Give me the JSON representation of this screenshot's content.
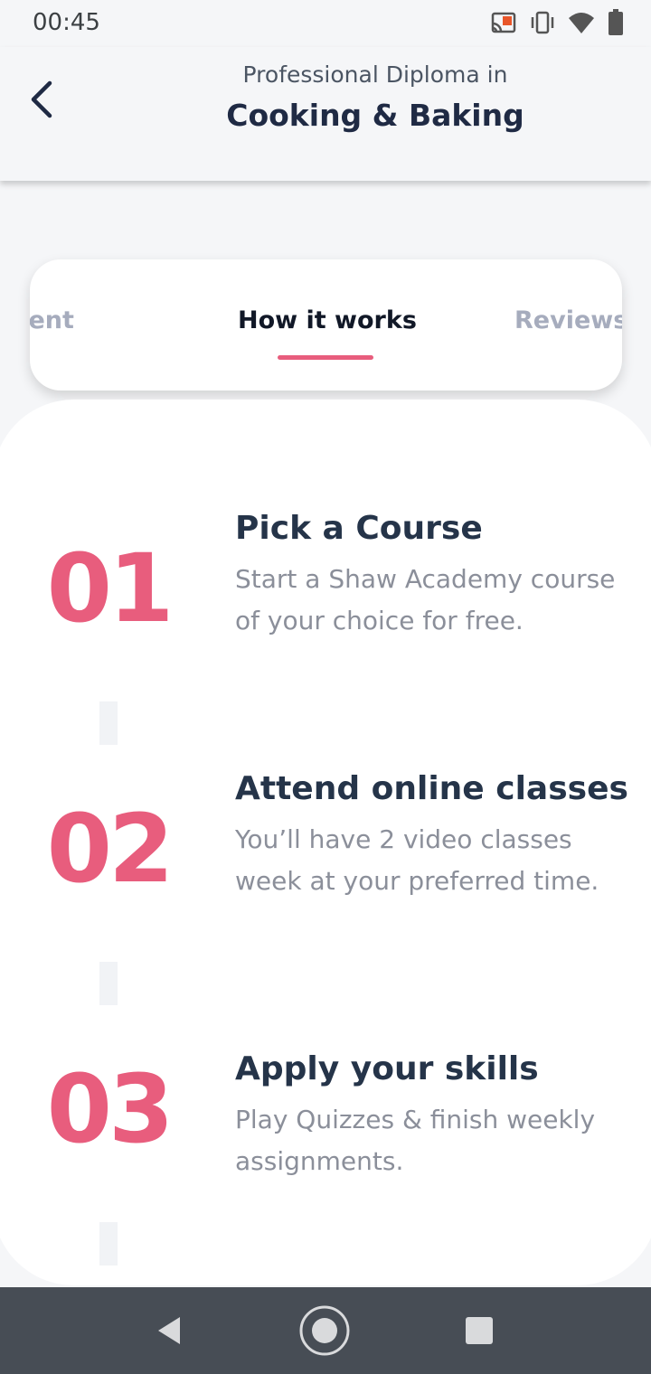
{
  "status_bar": {
    "time": "00:45",
    "icons": [
      "cast-icon",
      "vibrate-icon",
      "wifi-icon",
      "battery-icon"
    ]
  },
  "header": {
    "back_icon": "back-chevron-icon",
    "subtitle": "Professional Diploma in",
    "title": "Cooking & Baking"
  },
  "tabs": {
    "items": [
      {
        "label": "Content",
        "visible_text": "ontent",
        "active": false
      },
      {
        "label": "How it works",
        "active": true
      },
      {
        "label": "Reviews",
        "visible_text": "Review",
        "active": false
      }
    ]
  },
  "steps": [
    {
      "number": "01",
      "title": "Pick a Course",
      "description": "Start a Shaw Academy course of your choice for free."
    },
    {
      "number": "02",
      "title": "Attend online classes",
      "description": "You’ll have 2 video classes week at your preferred time."
    },
    {
      "number": "03",
      "title": "Apply your skills",
      "description": "Play Quizzes & finish weekly assignments."
    }
  ],
  "colors": {
    "accent": "#e85d7d",
    "title_dark": "#1f2a44",
    "text_muted": "#8b8f9a",
    "nav_bar": "#474d55"
  },
  "nav": {
    "icons": [
      "back-triangle-icon",
      "home-circle-icon",
      "recents-square-icon"
    ]
  }
}
